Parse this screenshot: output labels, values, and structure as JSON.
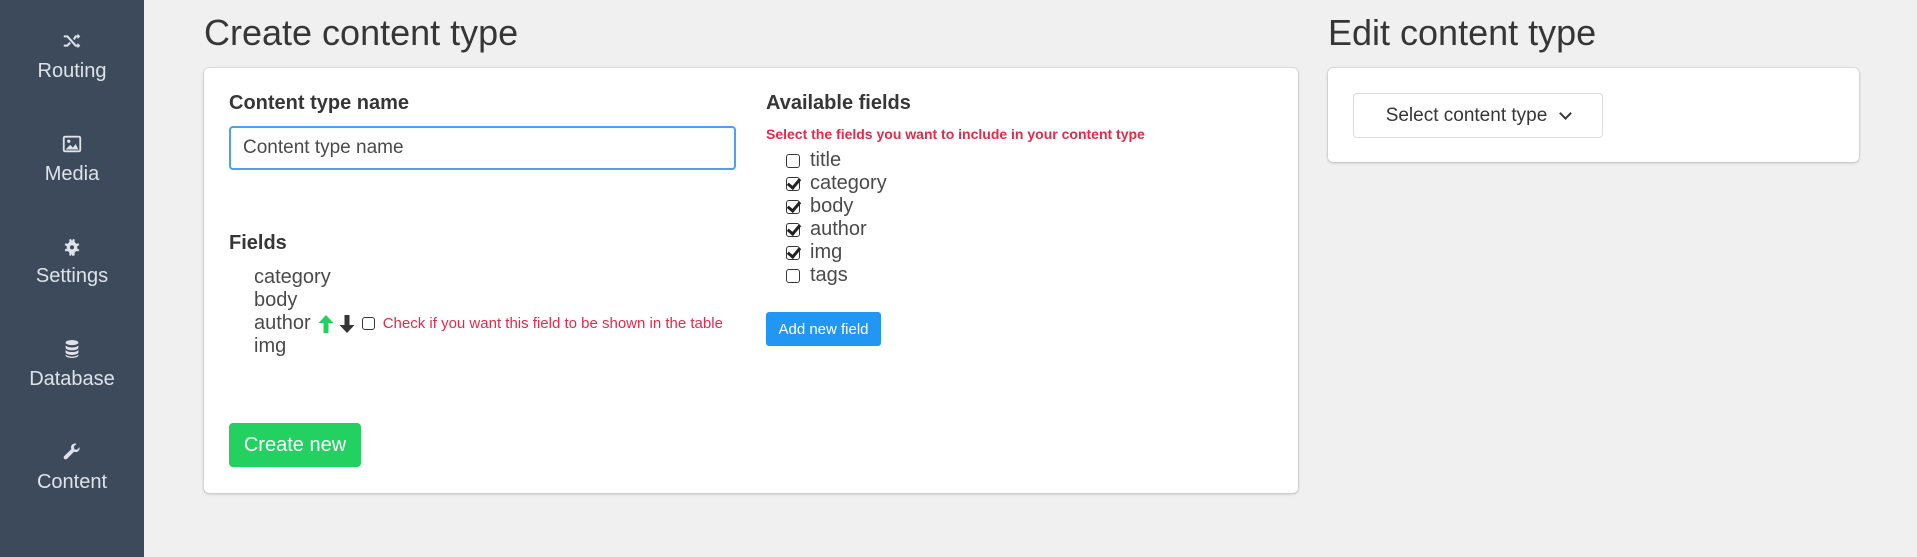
{
  "sidebar": {
    "items": [
      {
        "label": "Routing",
        "icon": "shuffle-icon"
      },
      {
        "label": "Media",
        "icon": "image-icon"
      },
      {
        "label": "Settings",
        "icon": "gear-icon"
      },
      {
        "label": "Database",
        "icon": "database-icon"
      },
      {
        "label": "Content",
        "icon": "wrench-icon"
      }
    ]
  },
  "create": {
    "title": "Create content type",
    "name_label": "Content type name",
    "name_placeholder": "Content type name",
    "fields_label": "Fields",
    "fields": [
      "category",
      "body",
      "author",
      "img"
    ],
    "table_hint": "Check if you want this field to be shown in the table",
    "available_label": "Available fields",
    "available_hint": "Select the fields you want to include in your content type",
    "available_fields": [
      {
        "name": "title",
        "checked": false
      },
      {
        "name": "category",
        "checked": true
      },
      {
        "name": "body",
        "checked": true
      },
      {
        "name": "author",
        "checked": true
      },
      {
        "name": "img",
        "checked": true
      },
      {
        "name": "tags",
        "checked": false
      }
    ],
    "add_field_button": "Add new field",
    "create_button": "Create new"
  },
  "edit": {
    "title": "Edit content type",
    "select_label": "Select content type"
  },
  "colors": {
    "sidebar_bg": "#3c4a5c",
    "accent_blue": "#2196f3",
    "accent_green": "#23d160",
    "hint_red": "#e5294a",
    "arrow_green": "#23d160"
  }
}
